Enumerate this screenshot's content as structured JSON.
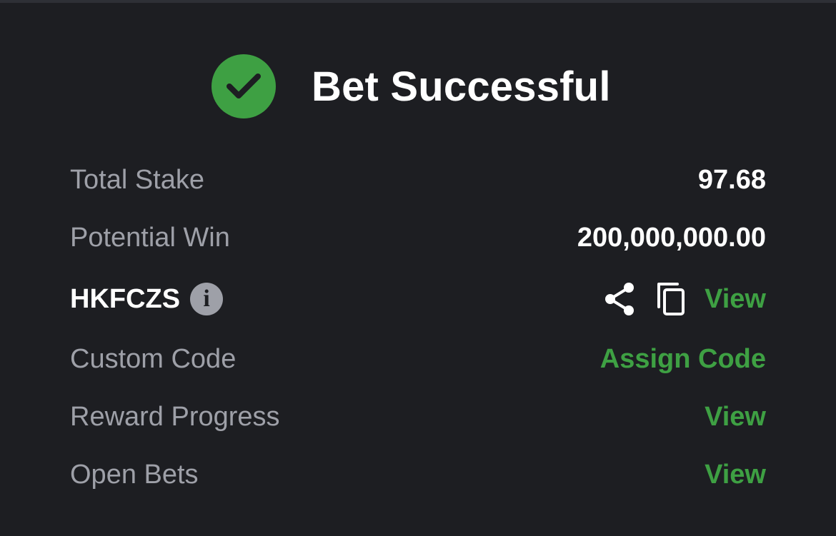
{
  "header": {
    "title": "Bet Successful",
    "icon": "checkmark-circle-icon",
    "success_color": "#3ea043"
  },
  "rows": {
    "total_stake": {
      "label": "Total Stake",
      "value": "97.68"
    },
    "potential_win": {
      "label": "Potential Win",
      "value": "200,000,000.00"
    },
    "bet_code": {
      "code": "HKFCZS",
      "info_glyph": "i",
      "share_icon": "share-icon",
      "copy_icon": "copy-icon",
      "view_label": "View"
    },
    "custom_code": {
      "label": "Custom Code",
      "action": "Assign Code"
    },
    "reward_progress": {
      "label": "Reward Progress",
      "action": "View"
    },
    "open_bets": {
      "label": "Open Bets",
      "action": "View"
    }
  },
  "colors": {
    "background": "#1d1e22",
    "label": "#9ea0a8",
    "accent": "#3ea043",
    "text": "#ffffff"
  }
}
